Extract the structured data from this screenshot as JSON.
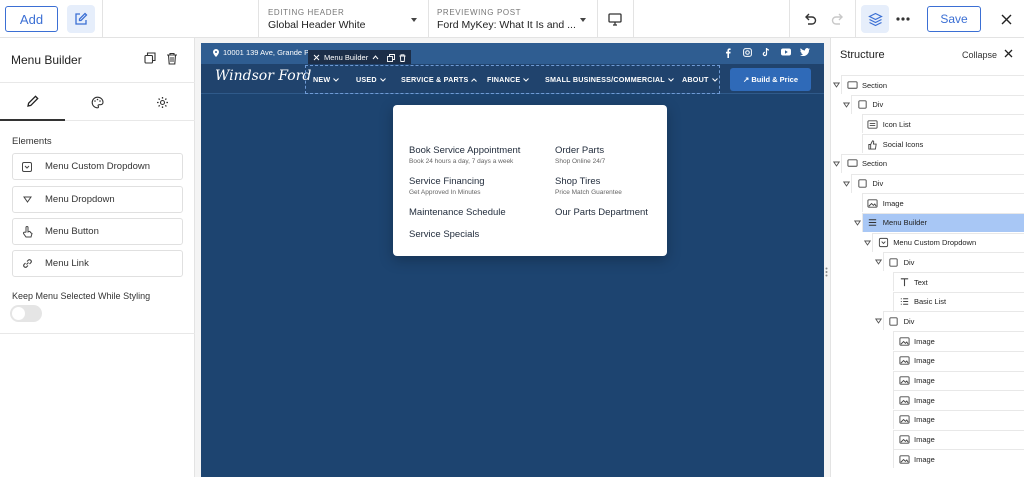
{
  "topbar": {
    "add_label": "Add",
    "editing_label": "EDITING HEADER",
    "editing_value": "Global Header White",
    "preview_label": "PREVIEWING POST",
    "preview_value": "Ford MyKey: What It Is and ...",
    "save_label": "Save",
    "accent_color": "#3b6fd4"
  },
  "left_panel": {
    "title": "Menu Builder",
    "elements_heading": "Elements",
    "elements": [
      {
        "label": "Menu Custom Dropdown",
        "icon": "dropdown-box-icon"
      },
      {
        "label": "Menu Dropdown",
        "icon": "triangle-down-icon"
      },
      {
        "label": "Menu Button",
        "icon": "pointer-hand-icon"
      },
      {
        "label": "Menu Link",
        "icon": "link-icon"
      }
    ],
    "keep_label": "Keep Menu Selected While Styling"
  },
  "site": {
    "address": "10001 139 Ave, Grande P",
    "menu_builder_tag": "Menu Builder",
    "logo": "Windsor Ford",
    "nav": [
      {
        "label": "NEW"
      },
      {
        "label": "USED"
      },
      {
        "label": "SERVICE & PARTS"
      },
      {
        "label": "FINANCE"
      },
      {
        "label": "SMALL BUSINESS/COMMERCIAL"
      },
      {
        "label": "ABOUT"
      }
    ],
    "build_label": "↗ Build & Price",
    "dropdown": {
      "left": [
        {
          "title": "Book Service Appointment",
          "sub": "Book 24 hours a day, 7 days a week"
        },
        {
          "title": "Service Financing",
          "sub": "Get Approved In Minutes"
        },
        {
          "title": "Maintenance Schedule",
          "sub": ""
        },
        {
          "title": "Service Specials",
          "sub": ""
        }
      ],
      "right": [
        {
          "title": "Order Parts",
          "sub": "Shop Online 24/7"
        },
        {
          "title": "Shop Tires",
          "sub": "Price Match Guarentee"
        },
        {
          "title": "Our Parts Department",
          "sub": ""
        }
      ]
    },
    "colors": {
      "header": "#2f5d91",
      "body": "#1d4470",
      "button": "#2f6ab8"
    }
  },
  "structure": {
    "title": "Structure",
    "collapse_label": "Collapse",
    "selected_color": "#a8c7f5",
    "rows": [
      {
        "label": "Section",
        "icon": "section-icon"
      },
      {
        "label": "Div",
        "icon": "div-icon"
      },
      {
        "label": "Icon List",
        "icon": "icon-list-icon"
      },
      {
        "label": "Social Icons",
        "icon": "thumbs-up-icon"
      },
      {
        "label": "Section",
        "icon": "section-icon"
      },
      {
        "label": "Div",
        "icon": "div-icon"
      },
      {
        "label": "Image",
        "icon": "image-icon"
      },
      {
        "label": "Menu Builder",
        "icon": "menu-icon"
      },
      {
        "label": "Menu Custom Dropdown",
        "icon": "dropdown-box-icon"
      },
      {
        "label": "Div",
        "icon": "div-icon"
      },
      {
        "label": "Text",
        "icon": "text-icon"
      },
      {
        "label": "Basic List",
        "icon": "list-icon"
      },
      {
        "label": "Div",
        "icon": "div-icon"
      },
      {
        "label": "Image",
        "icon": "image-icon"
      },
      {
        "label": "Image",
        "icon": "image-icon"
      },
      {
        "label": "Image",
        "icon": "image-icon"
      },
      {
        "label": "Image",
        "icon": "image-icon"
      },
      {
        "label": "Image",
        "icon": "image-icon"
      },
      {
        "label": "Image",
        "icon": "image-icon"
      },
      {
        "label": "Image",
        "icon": "image-icon"
      }
    ]
  }
}
